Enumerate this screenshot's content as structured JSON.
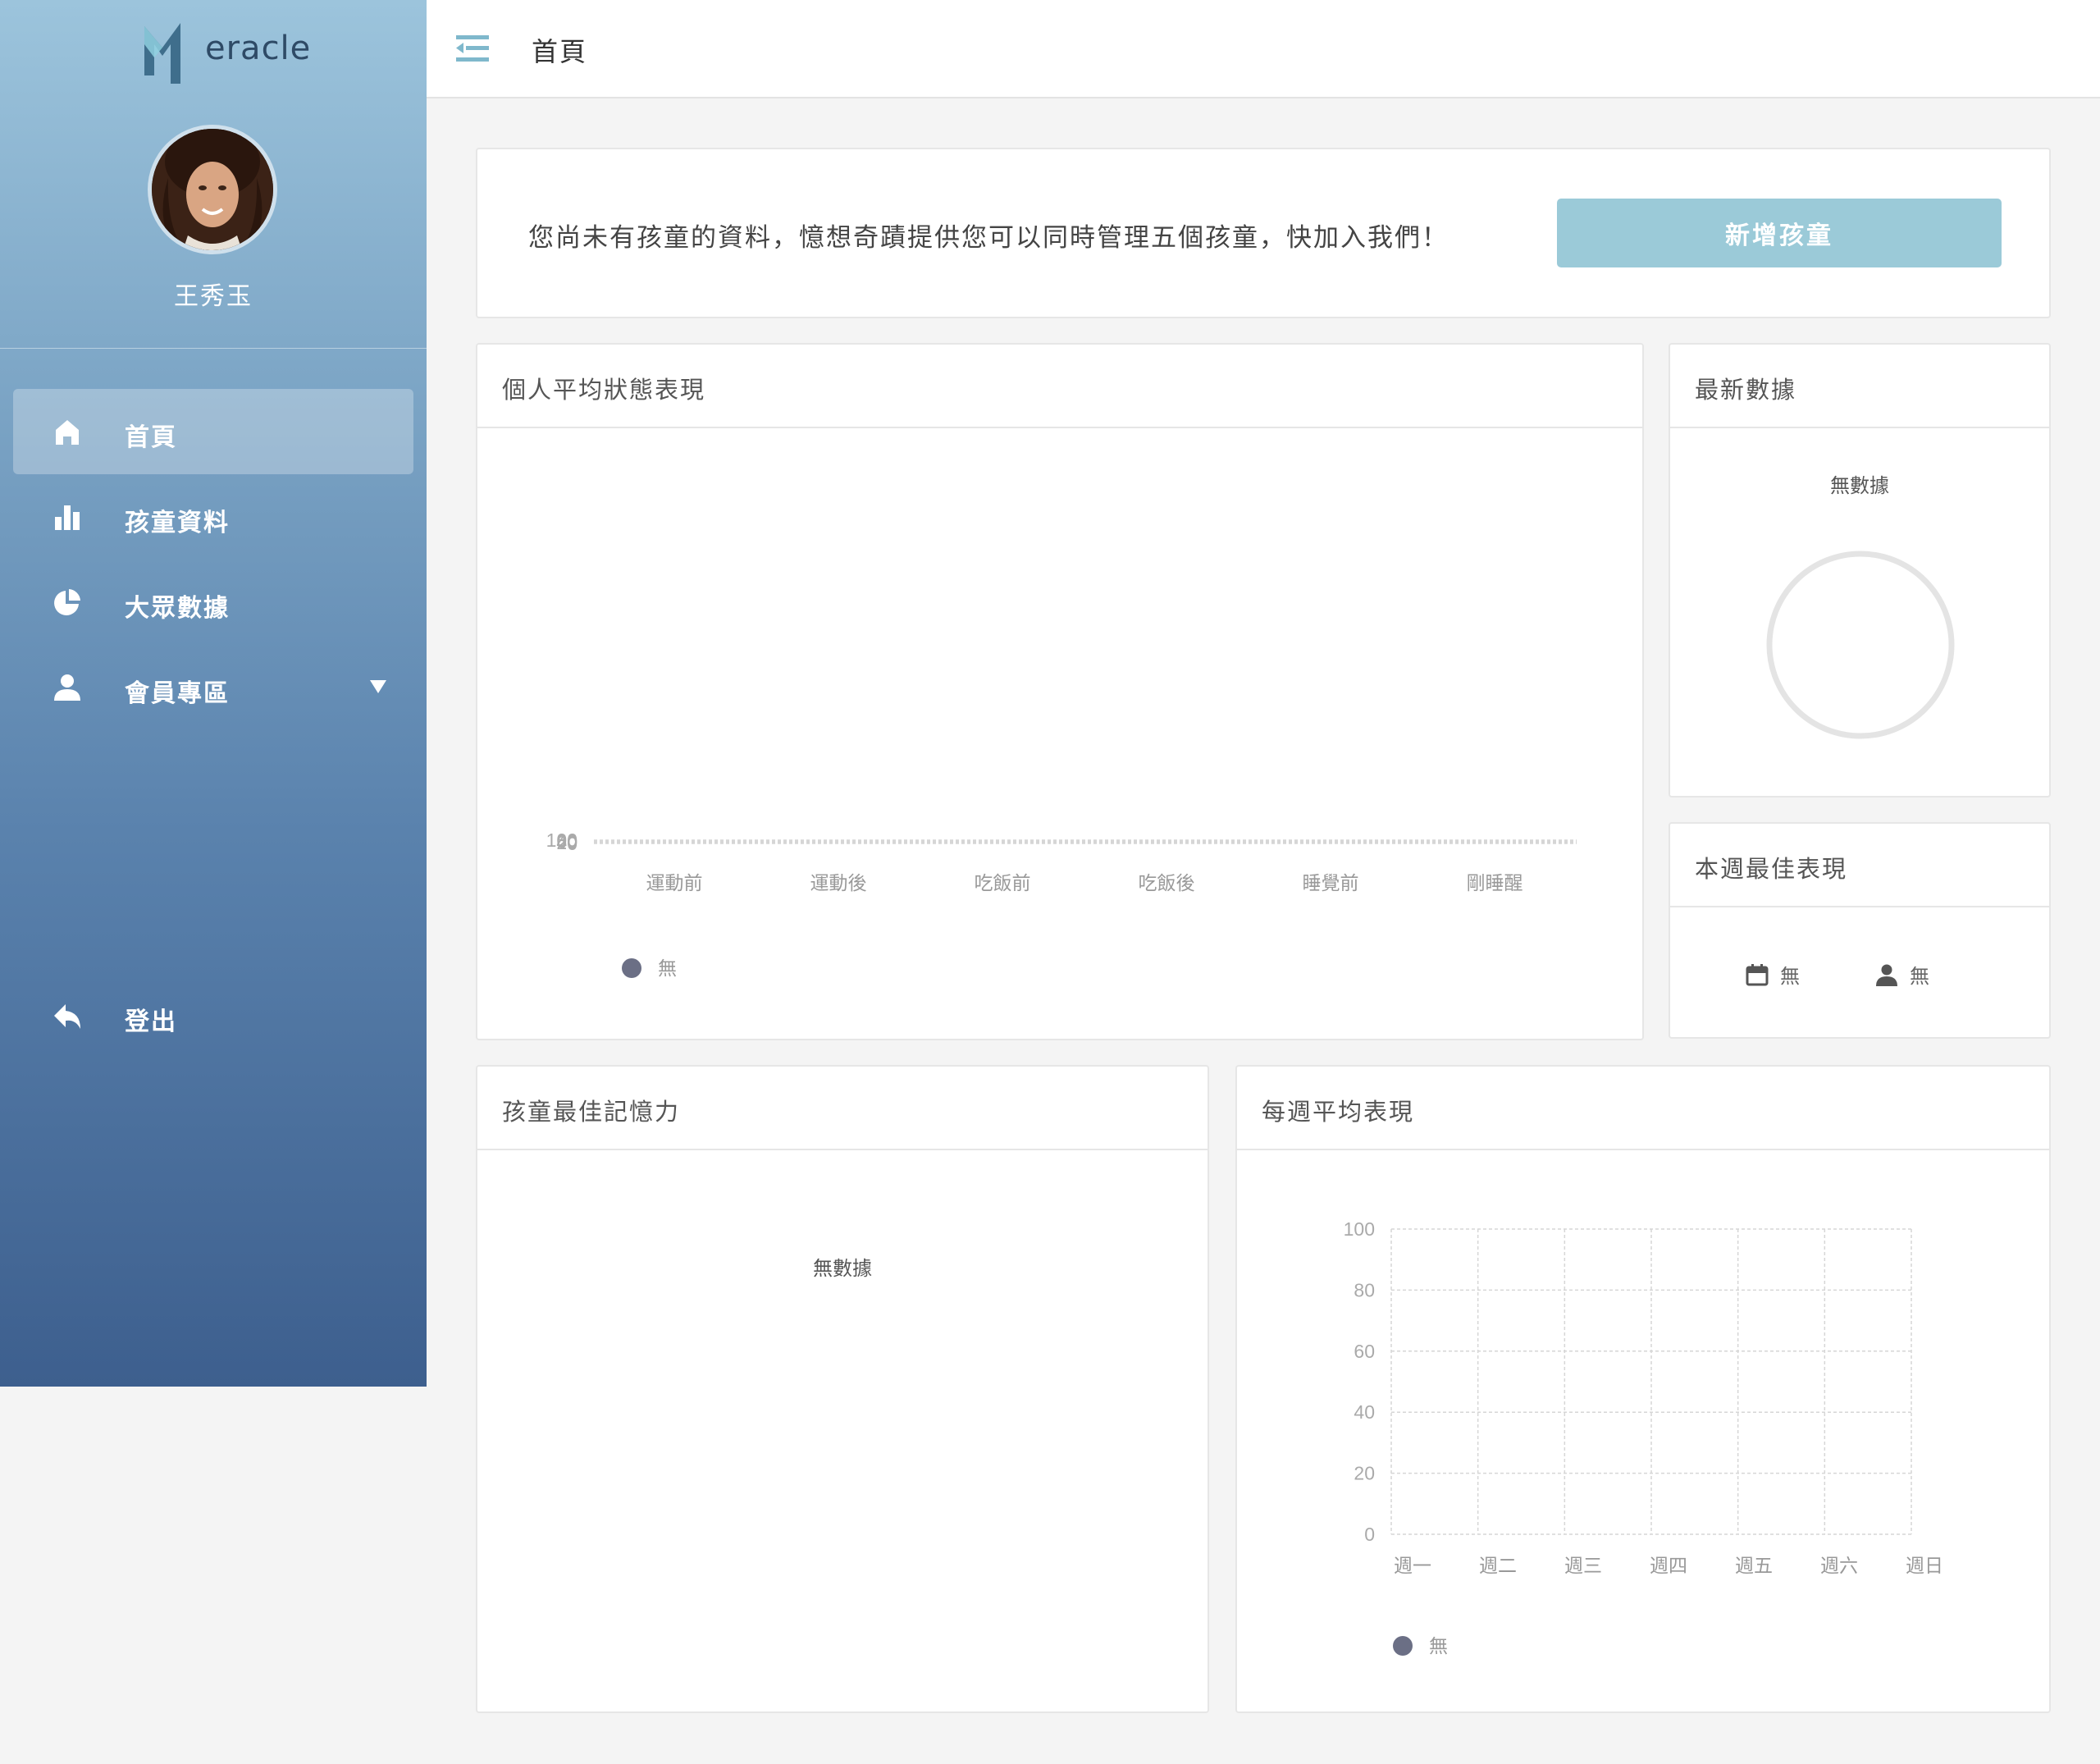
{
  "app": {
    "logo_letter": "M",
    "logo_word": "eracle"
  },
  "user": {
    "name": "王秀玉"
  },
  "sidebar": {
    "items": [
      {
        "label": "首頁",
        "icon": "home-icon",
        "active": true
      },
      {
        "label": "孩童資料",
        "icon": "bar-chart-icon"
      },
      {
        "label": "大眾數據",
        "icon": "pie-chart-icon"
      },
      {
        "label": "會員專區",
        "icon": "user-icon",
        "has_dropdown": true
      }
    ],
    "logout_label": "登出"
  },
  "header": {
    "title": "首頁"
  },
  "banner": {
    "text": "您尚未有孩童的資料，憶想奇蹟提供您可以同時管理五個孩童，快加入我們！",
    "button_label": "新增孩童"
  },
  "personal_avg": {
    "title": "個人平均狀態表現",
    "legend_label": "無"
  },
  "latest": {
    "title": "最新數據",
    "no_data": "無數據"
  },
  "week_best": {
    "title": "本週最佳表現",
    "date_value": "無",
    "person_value": "無"
  },
  "memory": {
    "title": "孩童最佳記憶力",
    "no_data": "無數據"
  },
  "weekly_avg": {
    "title": "每週平均表現",
    "legend_label": "無"
  },
  "colors": {
    "accent_button": "#9bcad8",
    "legend_dot": "#6b6f85",
    "sidebar_top": "#9cc4dc",
    "sidebar_bottom": "#3d5f8e"
  },
  "chart_data": [
    {
      "type": "line",
      "categories": [
        "運動前",
        "運動後",
        "吃飯前",
        "吃飯後",
        "睡覺前",
        "剛睡醒"
      ],
      "yticks": [
        "0",
        "20",
        "40",
        "60",
        "80",
        "100"
      ],
      "ylim": [
        0,
        100
      ],
      "series": [
        {
          "name": "無",
          "values": []
        }
      ],
      "grid": "horizontal-dashed",
      "legend": "bottom-left"
    },
    {
      "type": "line",
      "categories": [
        "週一",
        "週二",
        "週三",
        "週四",
        "週五",
        "週六",
        "週日"
      ],
      "yticks": [
        "0",
        "20",
        "40",
        "60",
        "80",
        "100"
      ],
      "ylim": [
        0,
        100
      ],
      "series": [
        {
          "name": "無",
          "values": []
        }
      ],
      "grid": "both-dashed",
      "legend": "bottom-left"
    }
  ]
}
